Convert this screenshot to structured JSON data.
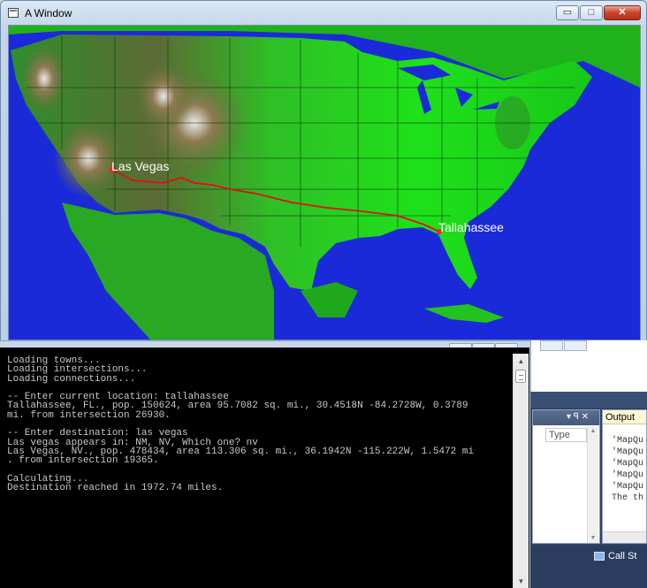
{
  "window": {
    "title": "A Window",
    "minimize_label": "▭",
    "maximize_label": "□",
    "close_label": "✕"
  },
  "map": {
    "route_color": "#e01010",
    "origin": {
      "name": "Las Vegas"
    },
    "destination": {
      "name": "Tallahassee"
    }
  },
  "console": {
    "lines": [
      "Loading towns...",
      "Loading intersections...",
      "Loading connections...",
      "",
      "-- Enter current location: tallahassee",
      "Tallahassee, FL., pop. 150624, area 95.7082 sq. mi., 30.4518N -84.2728W, 0.3789",
      "mi. from intersection 26930.",
      "",
      "-- Enter destination: las vegas",
      "Las vegas appears in: NM, NV, Which one? nv",
      "Las Vegas, NV., pop. 478434, area 113.306 sq. mi., 36.1942N -115.222W, 1.5472 mi",
      ". from intersection 19365.",
      "",
      "Calculating...",
      "Destination reached in 1972.74 miles."
    ]
  },
  "ide": {
    "properties": {
      "column_header": "Type",
      "pin_label": "▾ ꟼ ✕"
    },
    "output": {
      "tab_label": "Output",
      "lines": [
        "'MapQu",
        "'MapQu",
        "'MapQu",
        "'MapQu",
        "'MapQu",
        "The th"
      ]
    },
    "call_stack_label": "Call St"
  }
}
